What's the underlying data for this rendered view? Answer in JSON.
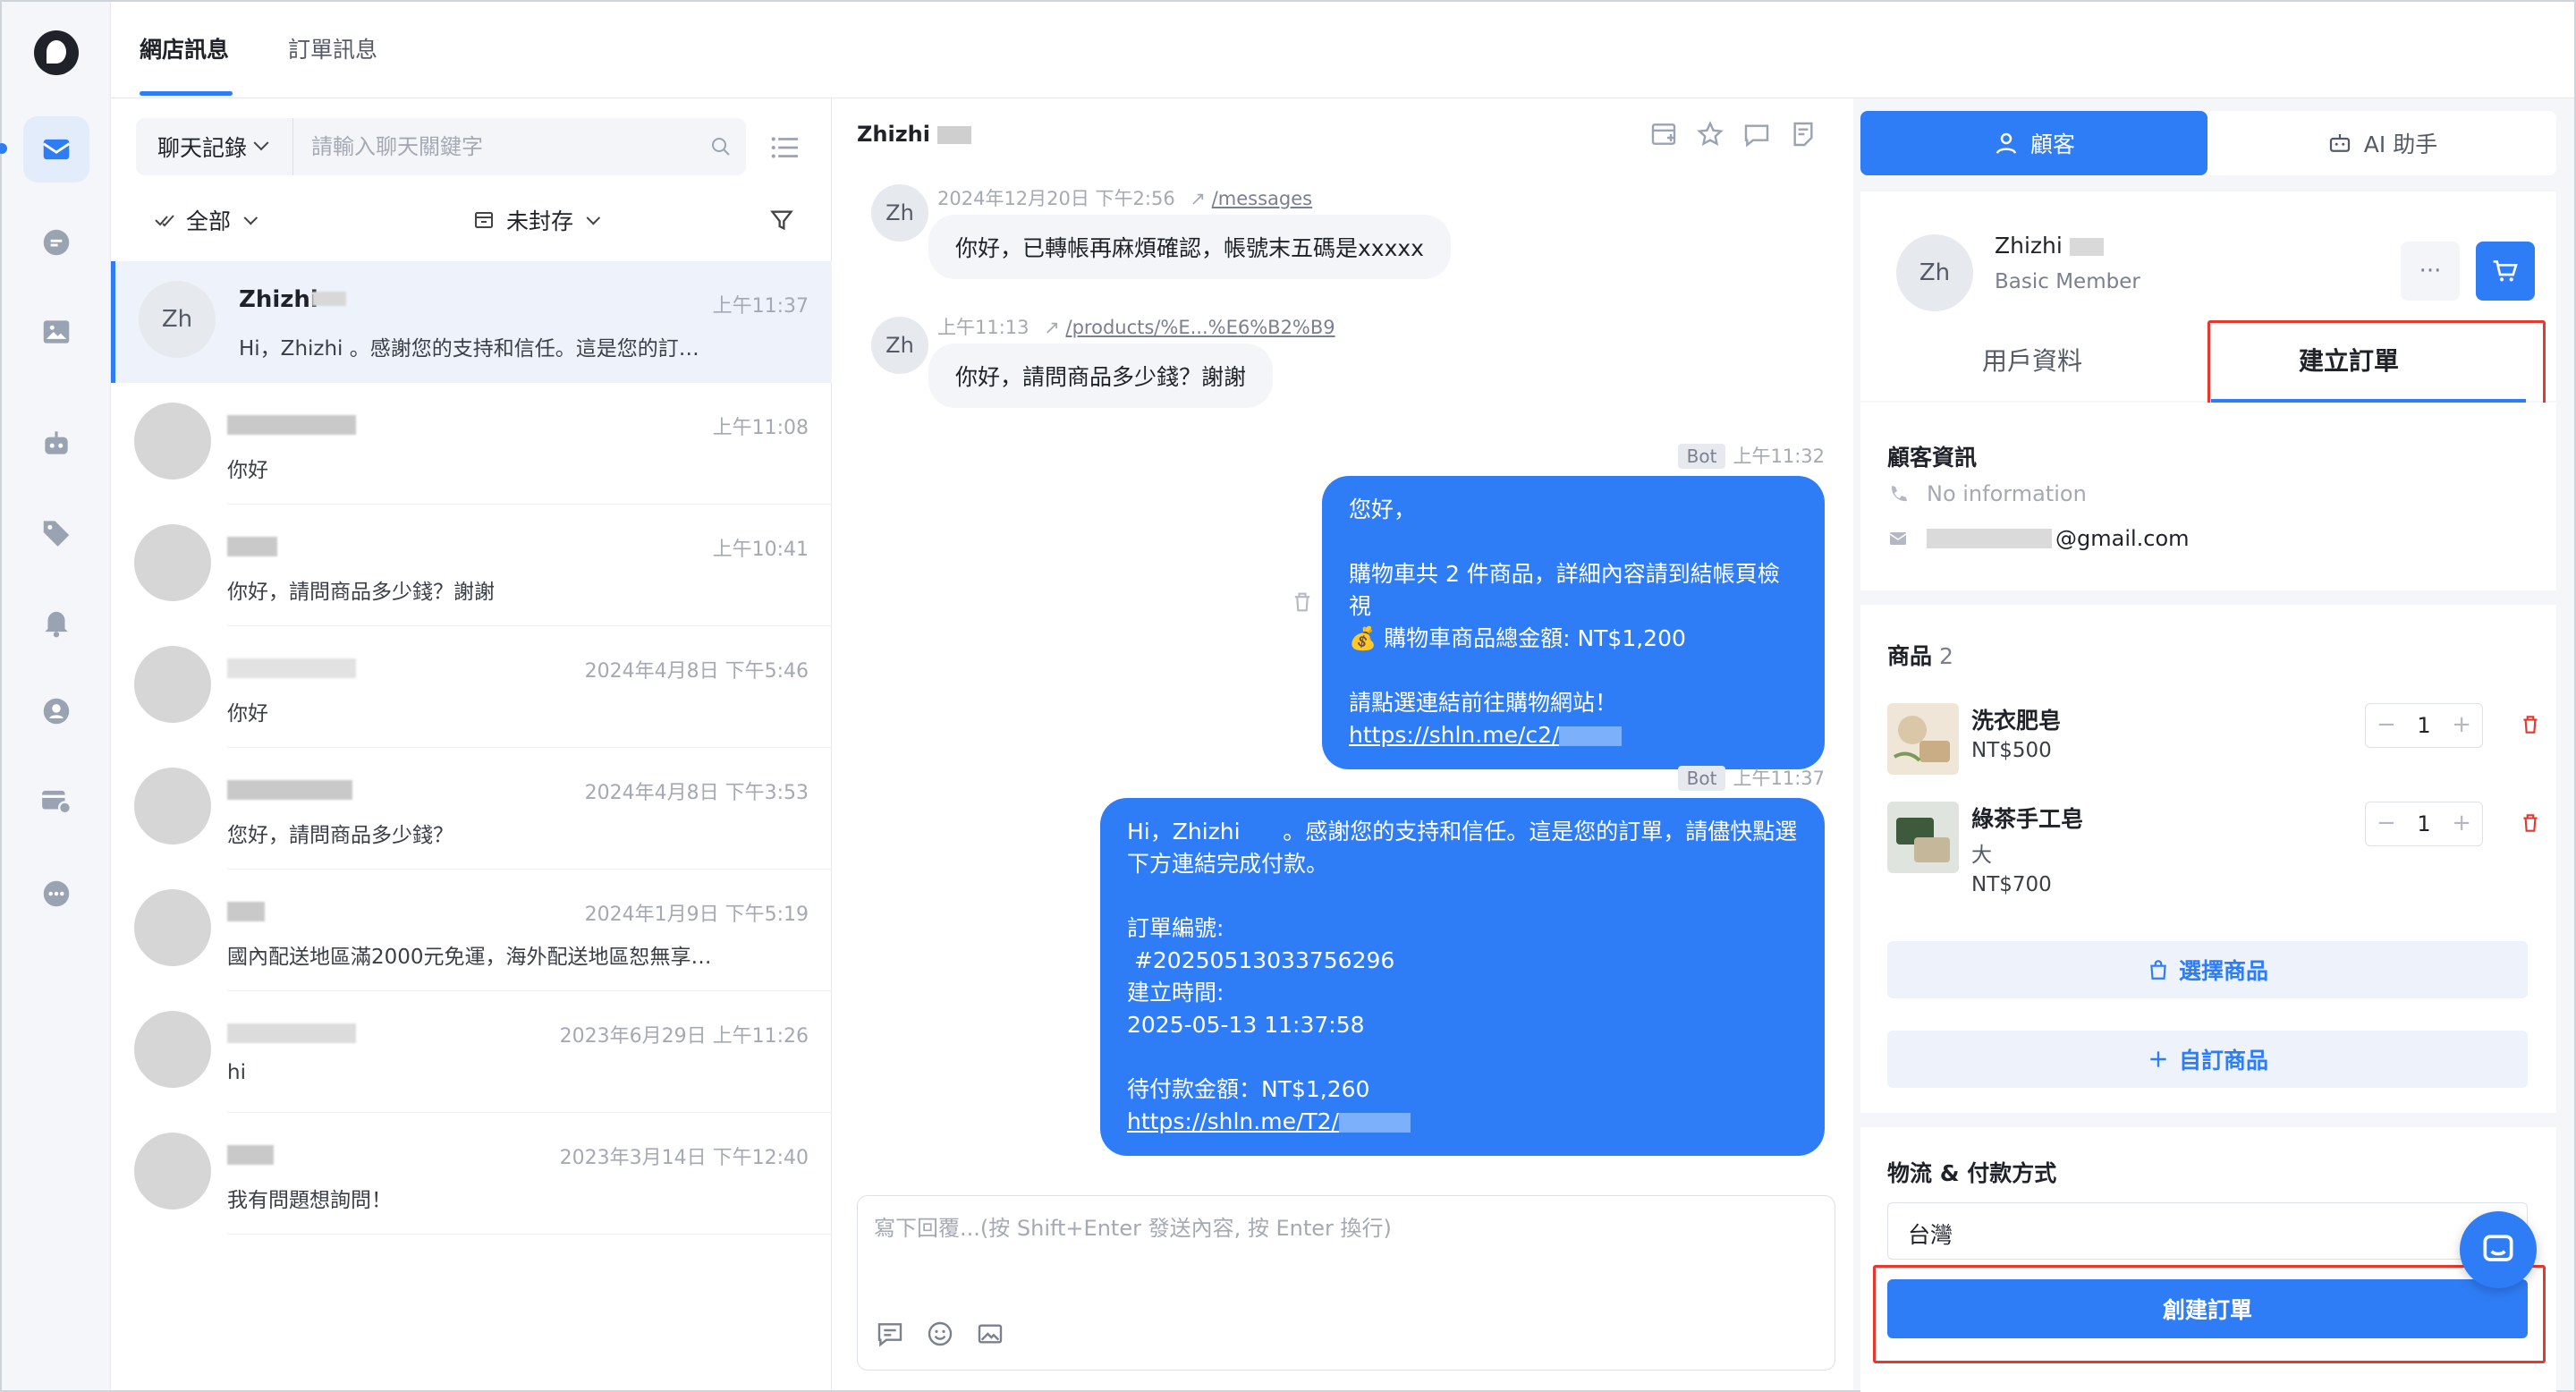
{
  "top_tabs": {
    "shop_messages": "網店訊息",
    "order_messages": "訂單訊息"
  },
  "list": {
    "search_type": "聊天記錄",
    "search_placeholder": "請輸入聊天關鍵字",
    "filter_all": "全部",
    "filter_archive": "未封存",
    "conversations": [
      {
        "avatar": "Zh",
        "name": "Zhizhi",
        "time": "上午11:37",
        "preview": "Hi，Zhizhi      。感謝您的支持和信任。這是您的訂…"
      },
      {
        "name": "",
        "time": "上午11:08",
        "preview": "你好"
      },
      {
        "name": "",
        "time": "上午10:41",
        "preview": "你好，請問商品多少錢？謝謝"
      },
      {
        "name": "",
        "time": "2024年4月8日 下午5:46",
        "preview": "你好"
      },
      {
        "name": "",
        "time": "2024年4月8日 下午3:53",
        "preview": "您好，請問商品多少錢？"
      },
      {
        "name": "",
        "time": "2024年1月9日 下午5:19",
        "preview": "國內配送地區滿2000元免運，海外配送地區恕無享…"
      },
      {
        "name": "",
        "time": "2023年6月29日 上午11:26",
        "preview": "hi"
      },
      {
        "name": "",
        "time": "2023年3月14日 下午12:40",
        "preview": "我有問題想詢問！"
      }
    ]
  },
  "chat": {
    "title": "Zhizhi",
    "messages": [
      {
        "avatar": "Zh",
        "time": "2024年12月20日 下午2:56",
        "link": "/messages",
        "text": "你好，已轉帳再麻煩確認，帳號末五碼是xxxxx"
      },
      {
        "avatar": "Zh",
        "time": "上午11:13",
        "link": "/products/%E...%E6%B2%B9",
        "text": "你好，請問商品多少錢？謝謝"
      }
    ],
    "bot_messages": [
      {
        "tag": "Bot",
        "time": "上午11:32",
        "lines": [
          "您好，",
          "",
          "購物車共 2 件商品，詳細內容請到結帳頁檢視",
          "💰 購物車商品總金額: NT$1,200",
          "",
          "請點選連結前往購物網站！"
        ],
        "link": "https://shln.me/c2/"
      },
      {
        "tag": "Bot",
        "time": "上午11:37",
        "lines": [
          "Hi，Zhizhi      。感謝您的支持和信任。這是您的訂單，請儘快點選",
          "下方連結完成付款。",
          "",
          "訂單編號:",
          " #20250513033756296",
          "建立時間:",
          "2025-05-13 11:37:58",
          "",
          "待付款金額：NT$1,260"
        ],
        "link": "https://shln.me/T2/"
      }
    ],
    "composer_placeholder": "寫下回覆...(按 Shift+Enter 發送內容, 按 Enter 換行)"
  },
  "panel": {
    "tab_customer": "顧客",
    "tab_ai": "AI 助手",
    "customer": {
      "avatar": "Zh",
      "name": "Zhizhi",
      "tier": "Basic Member",
      "more": "···"
    },
    "subtab_profile": "用戶資料",
    "subtab_create_order": "建立訂單",
    "info_title": "顧客資訊",
    "phone": "No information",
    "email": "@gmail.com",
    "products_title": "商品",
    "products_count": "2",
    "products": [
      {
        "name": "洗衣肥皂",
        "variant": "",
        "price": "NT$500",
        "qty": "1"
      },
      {
        "name": "綠茶手工皂",
        "variant": "大",
        "price": "NT$700",
        "qty": "1"
      }
    ],
    "choose_product": "選擇商品",
    "custom_product": "自訂商品",
    "logistics_title": "物流 & 付款方式",
    "region": "台灣",
    "create_order": "創建訂單"
  },
  "colors": {
    "accent": "#2f7df6",
    "highlight": "#e3392f"
  }
}
